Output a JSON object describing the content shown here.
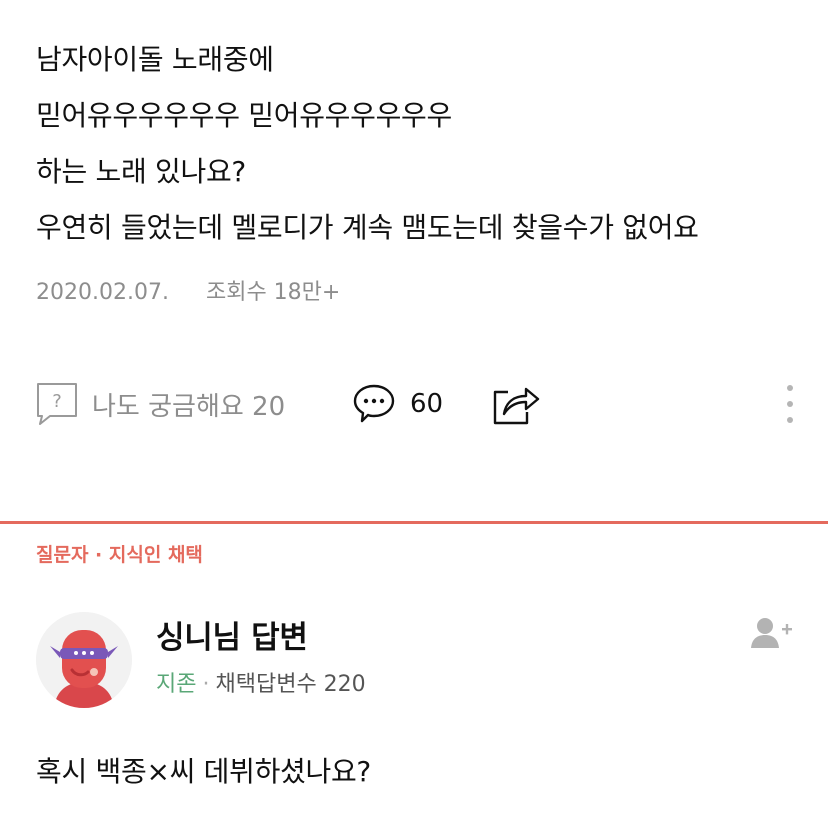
{
  "question": {
    "lines": [
      "남자아이돌 노래중에",
      "믿어유우우우우우 믿어유우우우우우",
      "하는 노래 있나요?",
      "우연히 들었는데 멜로디가 계속 맴도는데 찾을수가 없어요"
    ],
    "date": "2020.02.07.",
    "views": "조회수 18만+"
  },
  "actions": {
    "curious_label": "나도 궁금해요 20",
    "comment_count": "60"
  },
  "answer": {
    "chosen_label": "질문자 · 지식인 채택",
    "author_title": "싱니님 답변",
    "grade": "지존",
    "dot": "·",
    "adopted_count": "채택답변수 220",
    "text": "혹시 백종×씨 데뷔하셨나요?"
  },
  "colors": {
    "accent": "#e46a5d",
    "grade_green": "#5aa777",
    "meta_gray": "#8d8d8d"
  }
}
